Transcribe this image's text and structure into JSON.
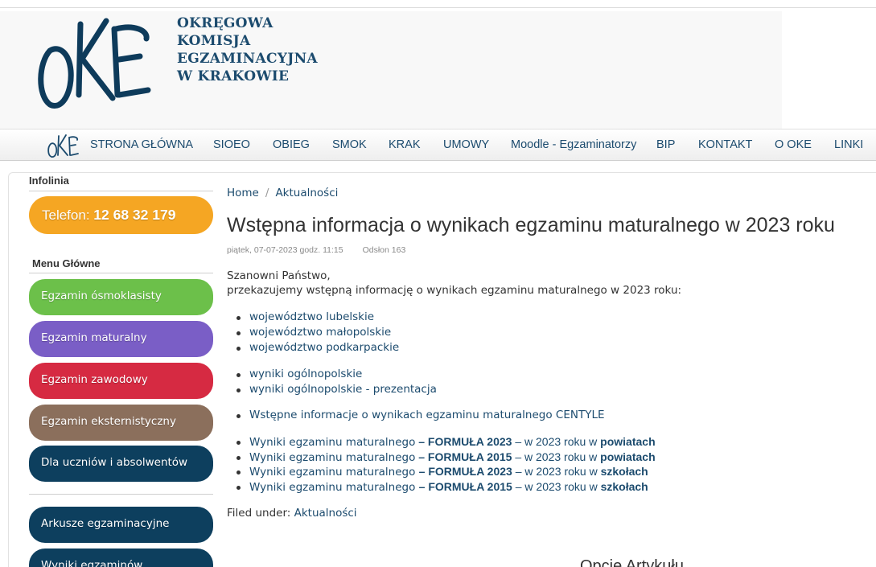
{
  "header": {
    "org_lines": [
      "OKRĘGOWA",
      "KOMISJA",
      "EGZAMINACYJNA",
      "W KRAKOWIE"
    ]
  },
  "nav": {
    "items": [
      "STRONA GŁÓWNA",
      "SIOEO",
      "OBIEG",
      "SMOK",
      "KRAK",
      "UMOWY",
      "Moodle - Egzaminatorzy",
      "BIP",
      "KONTAKT",
      "O OKE",
      "LINKI"
    ]
  },
  "sidebar": {
    "infolinia_title": "Infolinia",
    "phone_label": "Telefon:",
    "phone_number": "12 68 32 179",
    "menu_title": "Menu Główne",
    "menu_items": [
      {
        "label": "Egzamin ósmoklasisty",
        "color": "#6cc04a"
      },
      {
        "label": "Egzamin maturalny",
        "color": "#7a5ec6"
      },
      {
        "label": "Egzamin zawodowy",
        "color": "#d62a42"
      },
      {
        "label": "Egzamin eksternistyczny",
        "color": "#8b6f5c"
      },
      {
        "label": "Dla uczniów i absolwentów",
        "color": "#0d3f5e"
      }
    ],
    "extra_items": [
      {
        "label": "Arkusze egzaminacyjne",
        "color": "#0d3f5e"
      },
      {
        "label": "Wyniki egzaminów",
        "color": "#0d3f5e"
      }
    ]
  },
  "breadcrumb": [
    "Home",
    "Aktualności"
  ],
  "article": {
    "title": "Wstępna informacja o wynikach egzaminu maturalnego w 2023 roku",
    "date": "piątek, 07-07-2023 godz. 11:15",
    "hits": "Odsłon 163",
    "greeting": "Szanowni Państwo,",
    "intro": "przekazujemy wstępną informację o wynikach egzaminu maturalnego w 2023 roku:",
    "list1": [
      "województwo lubelskie",
      "województwo małopolskie",
      "województwo podkarpackie"
    ],
    "list2": [
      "wyniki ogólnopolskie",
      "wyniki ogólnopolskie - prezentacja"
    ],
    "list3": [
      "Wstępne informacje o wynikach egzaminu maturalnego CENTYLE"
    ],
    "list4": [
      {
        "a": "Wyniki egzaminu maturalnego",
        "b": " – ",
        "c": "FORMUŁA 2023",
        "d": " – w 2023 roku w ",
        "e": "powiatach"
      },
      {
        "a": "Wyniki egzaminu maturalnego",
        "b": " – ",
        "c": "FORMUŁA 2015",
        "d": " – w 2023 roku w ",
        "e": "powiatach"
      },
      {
        "a": "Wyniki egzaminu maturalnego ",
        "b": " – ",
        "c": "FORMUŁA 2023",
        "d": " – w 2023 roku w ",
        "e": "szkołach"
      },
      {
        "a": "Wyniki egzaminu maturalnego ",
        "b": " – ",
        "c": "FORMUŁA 2015",
        "d": " – w 2023 roku w ",
        "e": "szkołach"
      }
    ],
    "filed_label": "Filed under:",
    "filed_category": "Aktualności"
  },
  "options_heading": "Opcje Artykułu",
  "colors": {
    "brand": "#1c4b6e",
    "phone": "#f5a623"
  }
}
